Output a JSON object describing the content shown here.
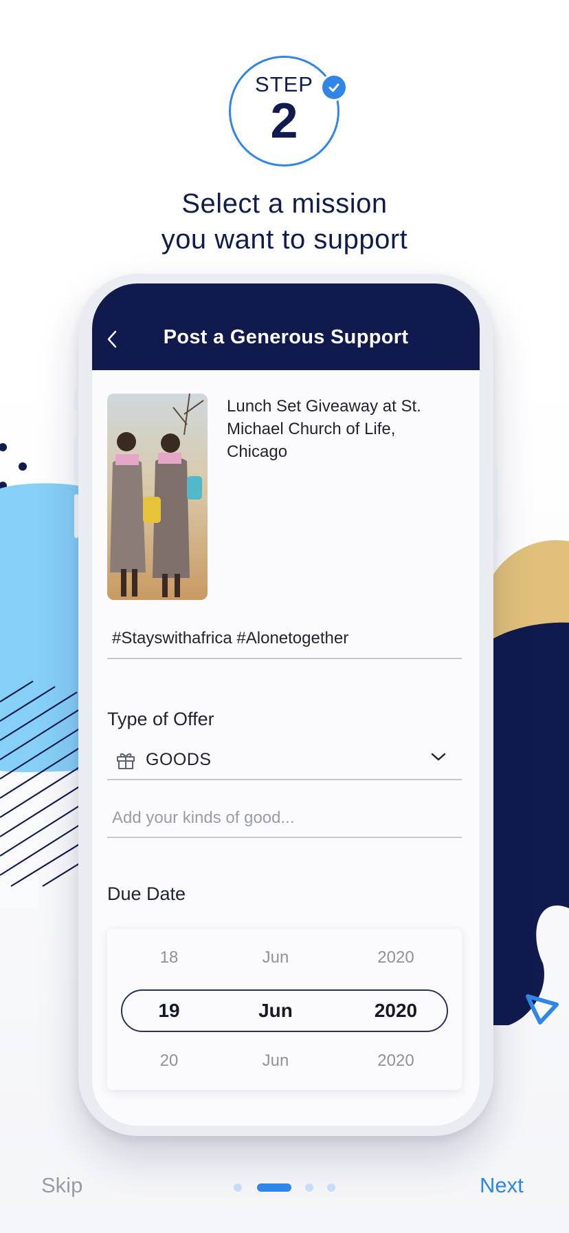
{
  "step": {
    "word": "STEP",
    "number": "2"
  },
  "headline": {
    "line1": "Select a mission",
    "line2": "you want to support"
  },
  "app": {
    "title": "Post a Generous Support",
    "mission": {
      "title": "Lunch Set Giveaway at St. Michael Church of Life, Chicago",
      "hashtags": "#Stayswithafrica #Alonetogether"
    },
    "offer": {
      "label": "Type of Offer",
      "icon": "gift-icon",
      "selected": "GOODS",
      "goods_placeholder": "Add your kinds of good..."
    },
    "due_date": {
      "label": "Due Date",
      "rows": [
        {
          "day": "18",
          "month": "Jun",
          "year": "2020"
        },
        {
          "day": "19",
          "month": "Jun",
          "year": "2020"
        },
        {
          "day": "20",
          "month": "Jun",
          "year": "2020"
        }
      ],
      "selected_index": 1
    }
  },
  "nav": {
    "skip": "Skip",
    "next": "Next",
    "pages": 4,
    "current_page": 2
  },
  "colors": {
    "navy": "#111a4d",
    "accent": "#2f86e6",
    "light_blue": "#86cff7",
    "gold": "#e0c07a"
  }
}
